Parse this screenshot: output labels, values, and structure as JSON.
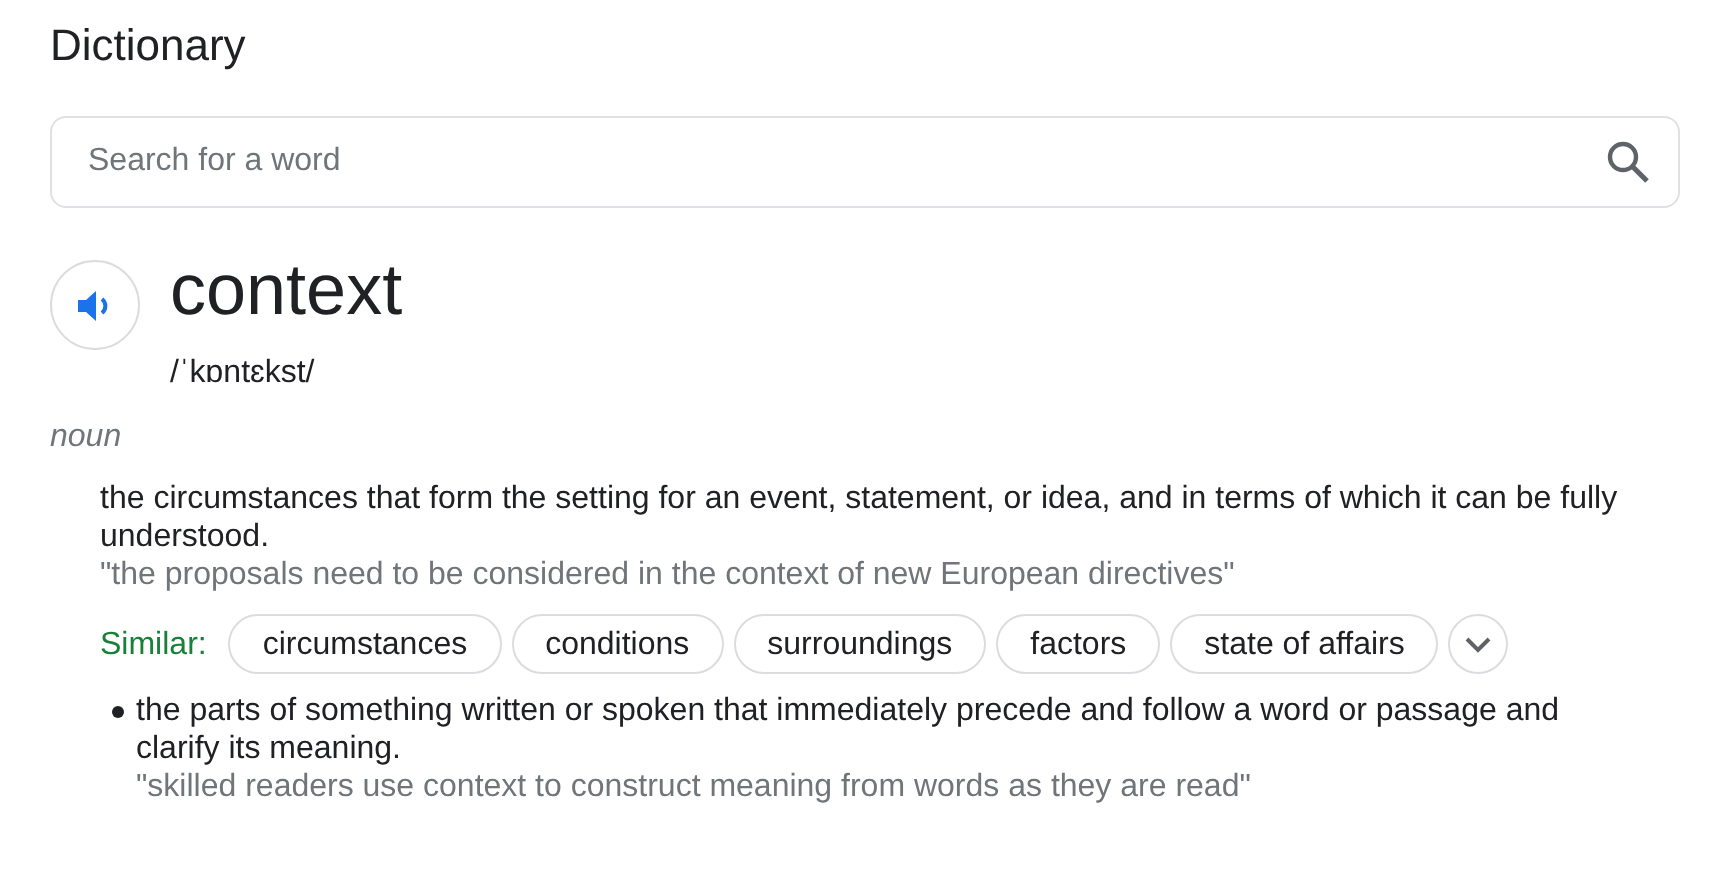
{
  "title": "Dictionary",
  "search": {
    "placeholder": "Search for a word"
  },
  "entry": {
    "word": "context",
    "pronunciation": "/ˈkɒntɛkst/",
    "part_of_speech": "noun",
    "senses": [
      {
        "kind": "plain",
        "definition": "the circumstances that form the setting for an event, statement, or idea, and in terms of which it can be fully understood.",
        "example": "\"the proposals need to be considered in the context of new European directives\"",
        "similar_label": "Similar:",
        "similar": [
          "circumstances",
          "conditions",
          "surroundings",
          "factors",
          "state of affairs"
        ]
      },
      {
        "kind": "bullet",
        "definition": "the parts of something written or spoken that immediately precede and follow a word or passage and clarify its meaning.",
        "example": "\"skilled readers use context to construct meaning from words as they are read\""
      }
    ]
  }
}
